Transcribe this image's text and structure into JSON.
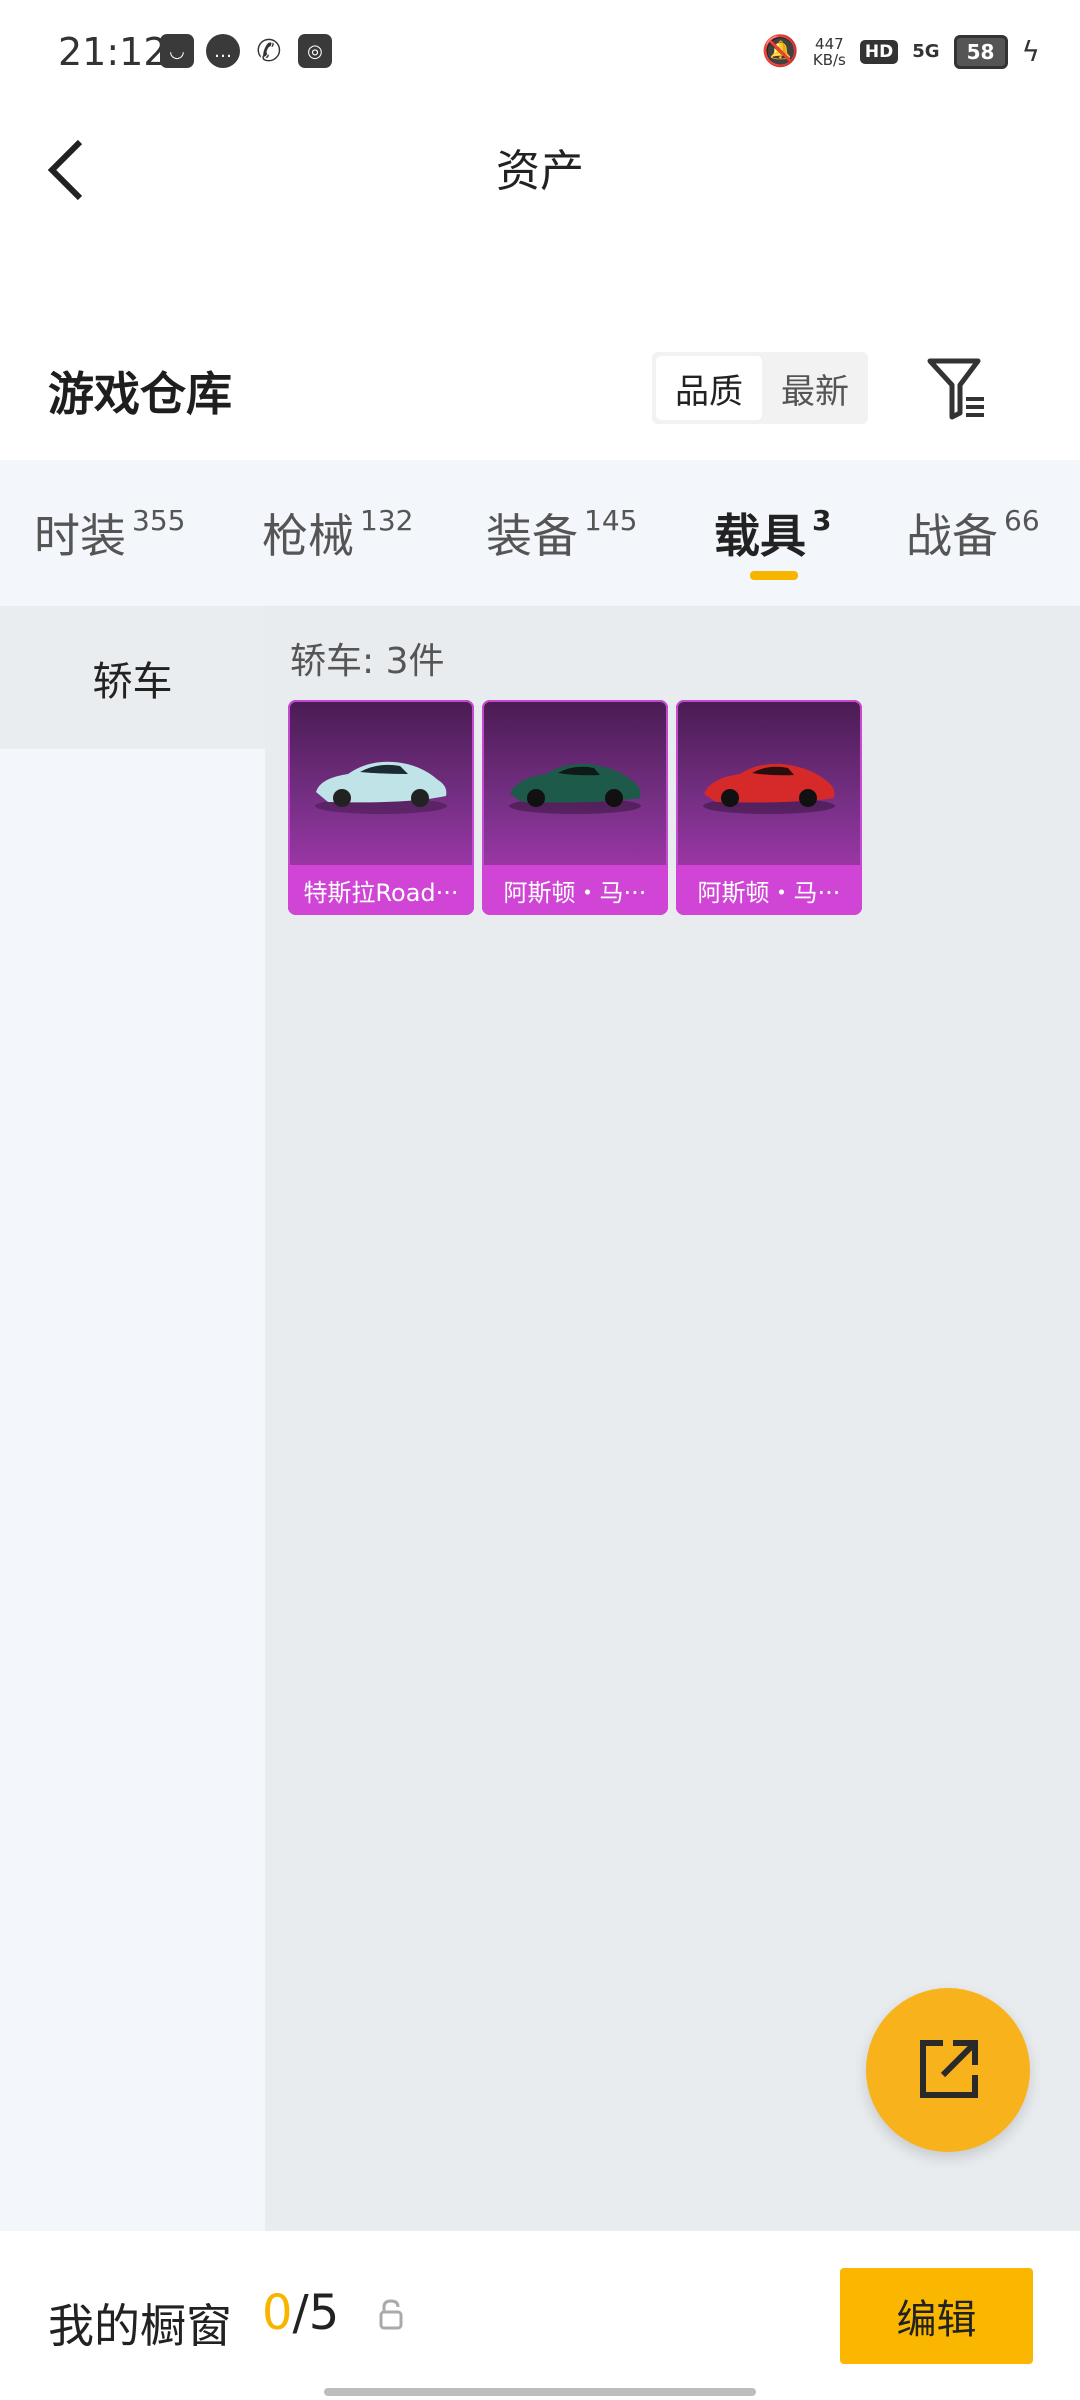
{
  "status_bar": {
    "time": "21:12",
    "speed": "447",
    "speed_unit": "KB/s",
    "hd": "HD",
    "network": "5G",
    "battery": "58"
  },
  "header": {
    "title": "资产"
  },
  "warehouse": {
    "title": "游戏仓库",
    "sort_options": [
      "品质",
      "最新"
    ]
  },
  "categories": [
    {
      "label": "时装",
      "count": "355"
    },
    {
      "label": "枪械",
      "count": "132"
    },
    {
      "label": "装备",
      "count": "145"
    },
    {
      "label": "载具",
      "count": "3"
    },
    {
      "label": "战备",
      "count": "66"
    }
  ],
  "sidebar": {
    "items": [
      {
        "label": "轿车"
      }
    ]
  },
  "content": {
    "count_text": "轿车: 3件",
    "items": [
      {
        "name": "特斯拉Road···",
        "color": "#bfe3e6"
      },
      {
        "name": "阿斯顿・马···",
        "color": "#1e5a4a"
      },
      {
        "name": "阿斯顿・马···",
        "color": "#d62a2a"
      }
    ]
  },
  "bottom_bar": {
    "label": "我的橱窗",
    "current": "0",
    "separator": "/",
    "total": "5",
    "edit_label": "编辑"
  },
  "colors": {
    "accent": "#f7b500",
    "card_gradient_top": "#4a1b52",
    "card_gradient_bottom": "#b43bbd"
  }
}
